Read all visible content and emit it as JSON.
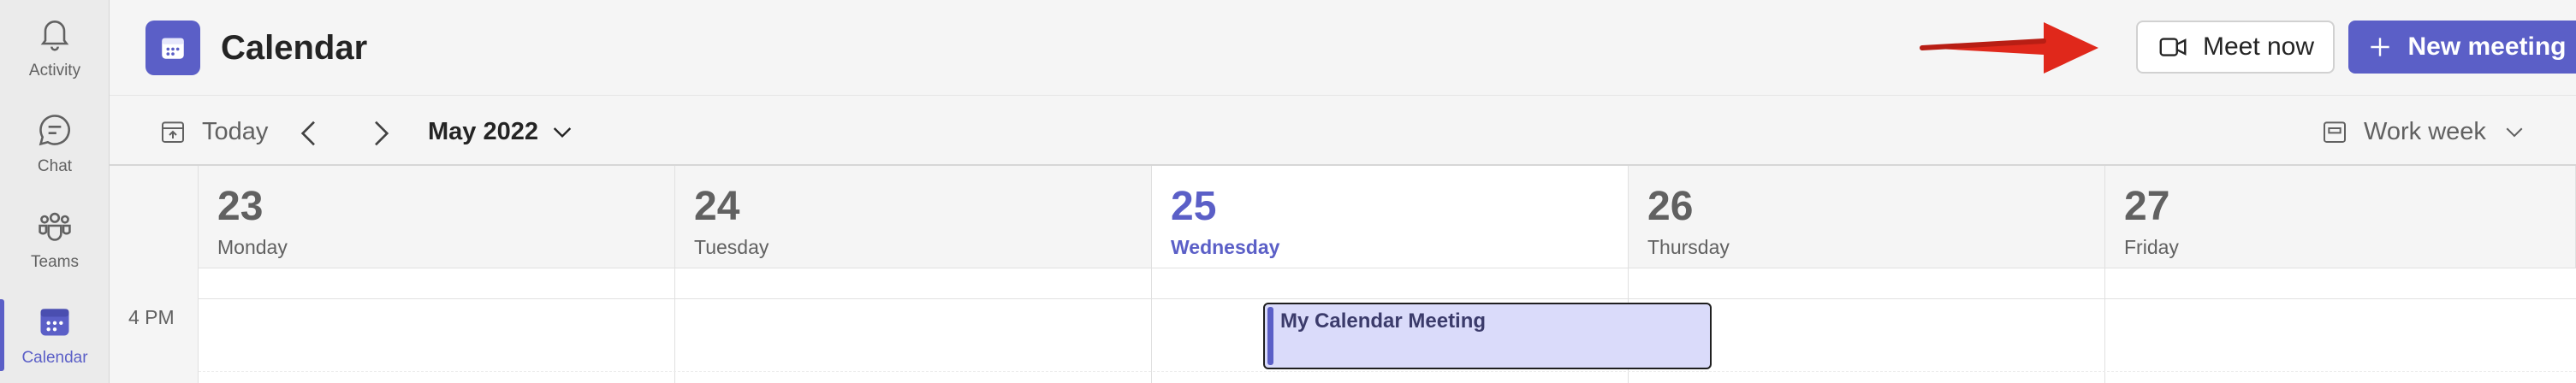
{
  "app": {
    "title": "Calendar",
    "accent_color": "#5b5fc7"
  },
  "rail": {
    "items": [
      {
        "label": "Activity",
        "icon": "bell-icon"
      },
      {
        "label": "Chat",
        "icon": "chat-icon"
      },
      {
        "label": "Teams",
        "icon": "teams-icon"
      },
      {
        "label": "Calendar",
        "icon": "calendar-icon",
        "active": true
      }
    ]
  },
  "header": {
    "meet_now_label": "Meet now",
    "new_meeting_label": "New meeting",
    "annotation_arrow_color": "#e0281b"
  },
  "toolbar": {
    "today_label": "Today",
    "month_label": "May 2022",
    "view_label": "Work week"
  },
  "calendar": {
    "days": [
      {
        "number": "23",
        "name": "Monday",
        "today": false
      },
      {
        "number": "24",
        "name": "Tuesday",
        "today": false
      },
      {
        "number": "25",
        "name": "Wednesday",
        "today": true
      },
      {
        "number": "26",
        "name": "Thursday",
        "today": false
      },
      {
        "number": "27",
        "name": "Friday",
        "today": false
      }
    ],
    "time_labels": [
      "4 PM"
    ],
    "events": [
      {
        "title": "My Calendar Meeting",
        "day": "25",
        "start": "4 PM"
      }
    ]
  }
}
